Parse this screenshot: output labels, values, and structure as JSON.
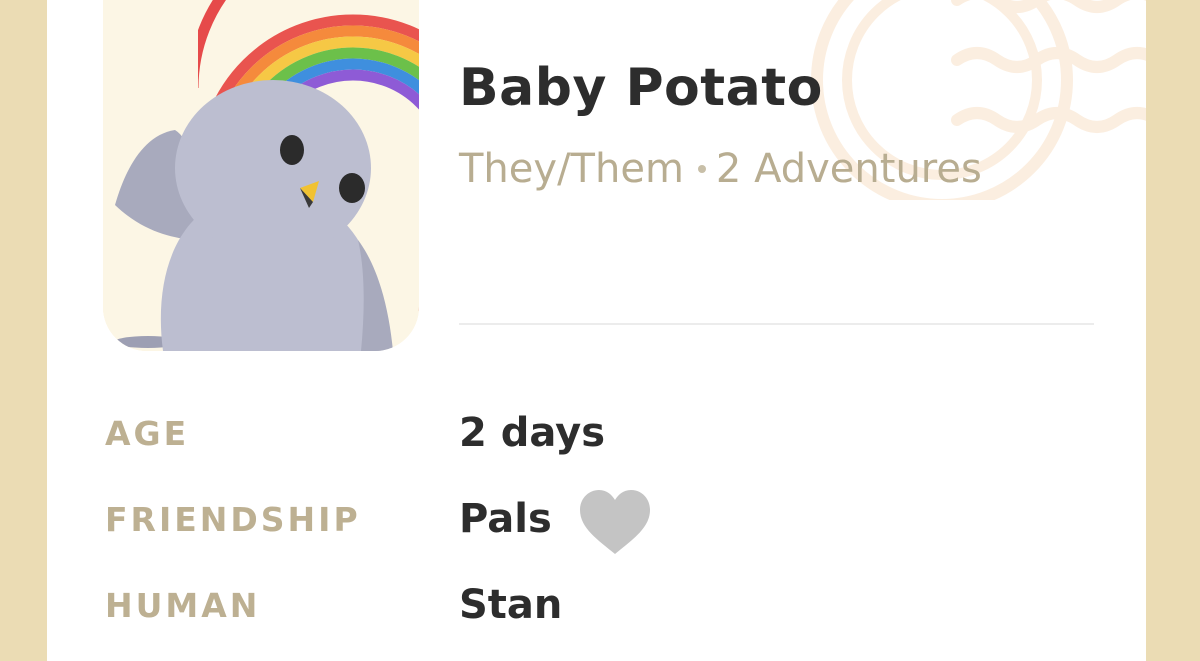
{
  "pet": {
    "name": "Baby Potato",
    "pronouns": "They/Them",
    "adventures": "2 Adventures"
  },
  "details": {
    "age_label": "AGE",
    "age_value": "2 days",
    "friendship_label": "FRIENDSHIP",
    "friendship_value": "Pals",
    "human_label": "HUMAN",
    "human_value": "Stan"
  },
  "icons": {
    "friendship": "heart-icon",
    "decoration": "postmark-stamp-icon"
  },
  "colors": {
    "frame": "#ebdcb4",
    "card": "#ffffff",
    "label": "#bdb092",
    "subtext": "#b8ad91",
    "value": "#2d2d2d",
    "heart": "#c4c4c4",
    "bird": "#bcbed0"
  }
}
